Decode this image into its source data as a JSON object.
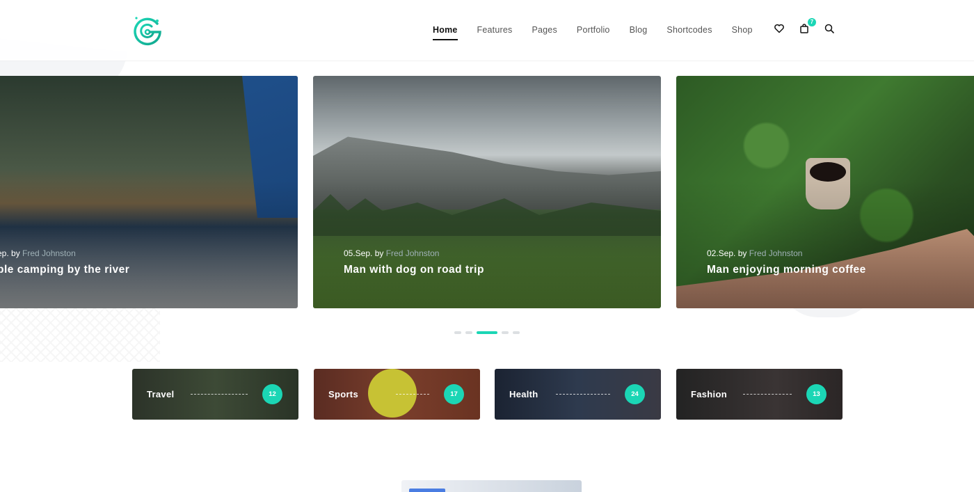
{
  "header": {
    "logo_alt": "G",
    "nav": [
      {
        "label": "Home",
        "active": true
      },
      {
        "label": "Features"
      },
      {
        "label": "Pages"
      },
      {
        "label": "Portfolio"
      },
      {
        "label": "Blog"
      },
      {
        "label": "Shortcodes"
      },
      {
        "label": "Shop"
      }
    ],
    "icons": [
      "heart-icon",
      "shopping-bag-icon",
      "search-icon"
    ],
    "cart_count": "7"
  },
  "slider": {
    "slides": [
      {
        "date": "ep.",
        "by": " by ",
        "author": "Fred Johnston",
        "title": "ple camping by the river"
      },
      {
        "date": "05.Sep.",
        "by": " by ",
        "author": "Fred Johnston",
        "title": "Man with dog on road trip"
      },
      {
        "date": "02.Sep.",
        "by": " by ",
        "author": "Fred Johnston",
        "title": "Man enjoying morning coffee"
      }
    ],
    "dots": 5,
    "active_dot": 3
  },
  "categories": [
    {
      "label": "Travel",
      "count": "12"
    },
    {
      "label": "Sports",
      "count": "17"
    },
    {
      "label": "Health",
      "count": "24"
    },
    {
      "label": "Fashion",
      "count": "13"
    }
  ],
  "colors": {
    "accent": "#1bd6b5",
    "text": "#222222"
  }
}
